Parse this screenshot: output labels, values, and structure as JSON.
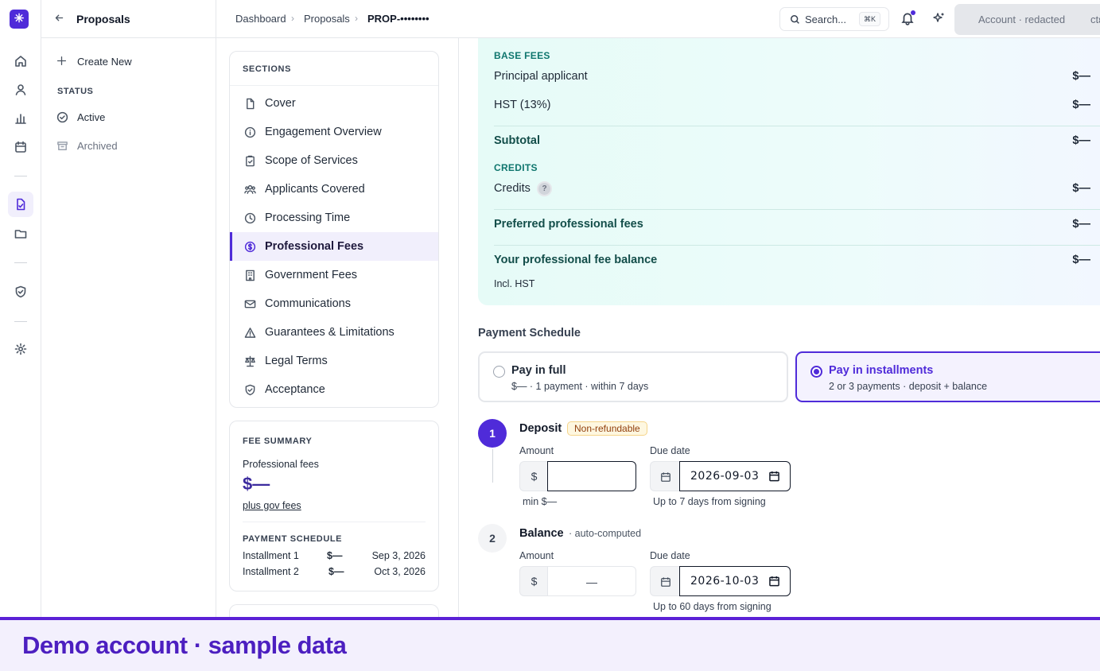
{
  "sidebar": {
    "title": "Proposals",
    "create_new": "Create New",
    "status_heading": "STATUS",
    "status_items": [
      "Active",
      "Archived"
    ]
  },
  "topbar": {
    "breadcrumbs": [
      "Dashboard",
      "Proposals",
      "PROP-••••••••"
    ],
    "search_placeholder": "Search...",
    "search_shortcut": "⌘K",
    "account_label": "Account · redacted",
    "account_overflow": "ctε"
  },
  "sections": {
    "heading": "SECTIONS",
    "items": [
      {
        "label": "Cover",
        "icon": "document-icon"
      },
      {
        "label": "Engagement Overview",
        "icon": "info-icon"
      },
      {
        "label": "Scope of Services",
        "icon": "clipboard-icon"
      },
      {
        "label": "Applicants Covered",
        "icon": "users-icon"
      },
      {
        "label": "Processing Time",
        "icon": "clock-icon"
      },
      {
        "label": "Professional Fees",
        "icon": "dollar-circle-icon",
        "active": true
      },
      {
        "label": "Government Fees",
        "icon": "building-icon"
      },
      {
        "label": "Communications",
        "icon": "mail-icon"
      },
      {
        "label": "Guarantees & Limitations",
        "icon": "warning-icon"
      },
      {
        "label": "Legal Terms",
        "icon": "scale-icon"
      },
      {
        "label": "Acceptance",
        "icon": "shield-check-icon"
      }
    ]
  },
  "fee_summary": {
    "heading": "FEE SUMMARY",
    "professional_fees_label": "Professional fees",
    "professional_fees_value": "$—",
    "gov_link": "plus gov fees",
    "schedule_heading": "PAYMENT SCHEDULE",
    "installments": [
      {
        "label": "Installment 1",
        "amount": "$—",
        "date": "Sep 3, 2026"
      },
      {
        "label": "Installment 2",
        "amount": "$—",
        "date": "Oct 3, 2026"
      }
    ]
  },
  "fees": {
    "base_heading": "BASE FEES",
    "principal_label": "Principal applicant",
    "principal_value": "$—",
    "hst_label": "HST (13%)",
    "hst_value": "$—",
    "subtotal_label": "Subtotal",
    "subtotal_value": "$—",
    "credits_heading": "CREDITS",
    "credits_label": "Credits",
    "credits_value": "$—",
    "preferred_label": "Preferred professional fees",
    "preferred_value": "$—",
    "balance_label": "Your professional fee balance",
    "balance_value": "$—",
    "incl_hst": "Incl. HST"
  },
  "payment": {
    "heading": "Payment Schedule",
    "option_full_title": "Pay in full",
    "option_full_sub": "$— · 1 payment · within 7 days",
    "option_inst_title": "Pay in installments",
    "option_inst_sub": "2 or 3 payments · deposit + balance",
    "selected": "installments",
    "deposit": {
      "step": "1",
      "title": "Deposit",
      "badge": "Non-refundable",
      "amount_label": "Amount",
      "currency": "$",
      "amount_value": "",
      "min_hint": "min $—",
      "due_label": "Due date",
      "due_value": "2026-09-03",
      "due_hint": "Up to 7 days from signing"
    },
    "balance": {
      "step": "2",
      "title": "Balance",
      "note": "· auto-computed",
      "amount_label": "Amount",
      "currency": "$",
      "amount_value": "—",
      "due_label": "Due date",
      "due_value": "2026-10-03",
      "due_hint": "Up to 60 days from signing"
    }
  },
  "banner": {
    "text": "Demo account · sample data"
  },
  "colors": {
    "accent": "#4f2bd9",
    "teal": "#0f766e",
    "banner": "#4c1fc0"
  }
}
